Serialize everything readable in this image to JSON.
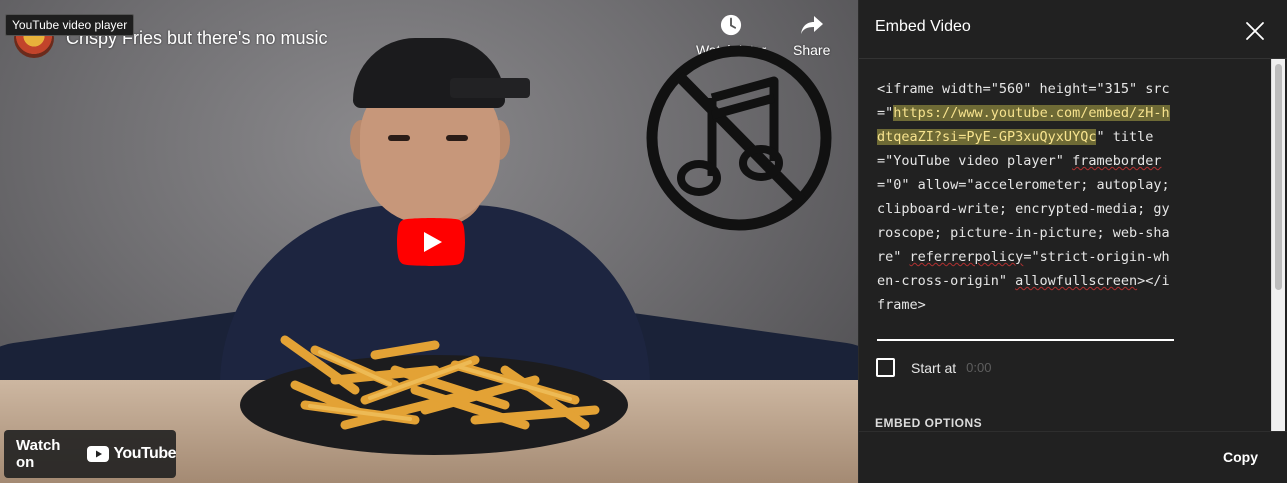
{
  "player": {
    "tooltip": "YouTube video player",
    "title": "Crispy Fries but there's no music",
    "watch_later_label": "Watch later",
    "share_label": "Share",
    "watch_on_label": "Watch on",
    "youtube_wordmark": "YouTube",
    "play_button_color": "#ff0000",
    "overlay_icon": "no-music-icon"
  },
  "embed": {
    "header": "Embed Video",
    "code": {
      "line1": "<iframe width=\"560\" height=\"315\"",
      "src_prefix": " src=\"",
      "src_url": "https://www.youtube.com/embed/zH-hdtqeaZI?si=PyE-GP3xuQyxUYQc",
      "src_suffix": "\"",
      "title_attr": " title=\"YouTube video player\"",
      "frameborder_word": "frameborder",
      "frameborder_value": "=\"0\"",
      "allow_attr": " allow=\"accelerometer; autoplay; clipboard-write; encrypted-media; gyroscope; picture-in-picture; web-share\" ",
      "referrer_word": "referrerpolicy",
      "referrer_value": "=\"strict-origin-when-cross-origin\" ",
      "allowfullscreen_word": "allowfullscreen",
      "closing": "></iframe>"
    },
    "start_at_label": "Start at",
    "start_at_placeholder": "0:00",
    "embed_options_heading": "EMBED OPTIONS",
    "copy_label": "Copy",
    "highlight_color": "#6e6a35"
  }
}
